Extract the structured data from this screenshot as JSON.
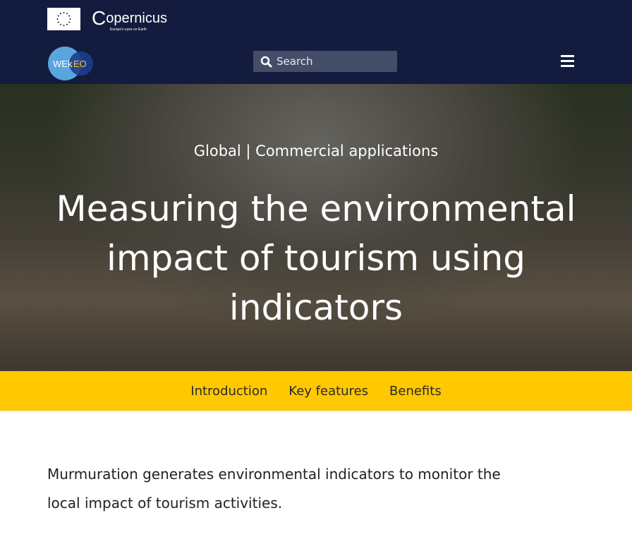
{
  "header": {
    "eu_logo": "EU flag",
    "copernicus_logo": "Copernicus",
    "copernicus_tagline": "Europe's eyes on Earth",
    "wekeo_logo": "WEkEO",
    "search_placeholder": "Search",
    "menu_icon": "hamburger-icon"
  },
  "hero": {
    "kicker": "Global | Commercial applications",
    "title": "Measuring the environmental impact of tourism using indicators"
  },
  "subnav": {
    "items": [
      {
        "label": "Introduction"
      },
      {
        "label": "Key features"
      },
      {
        "label": "Benefits"
      }
    ]
  },
  "intro": {
    "text": "Murmuration generates environmental indicators to monitor the local impact of tourism activities."
  },
  "colors": {
    "header": "#131c3e",
    "subnav": "#ffc800",
    "search": "#444d68"
  }
}
